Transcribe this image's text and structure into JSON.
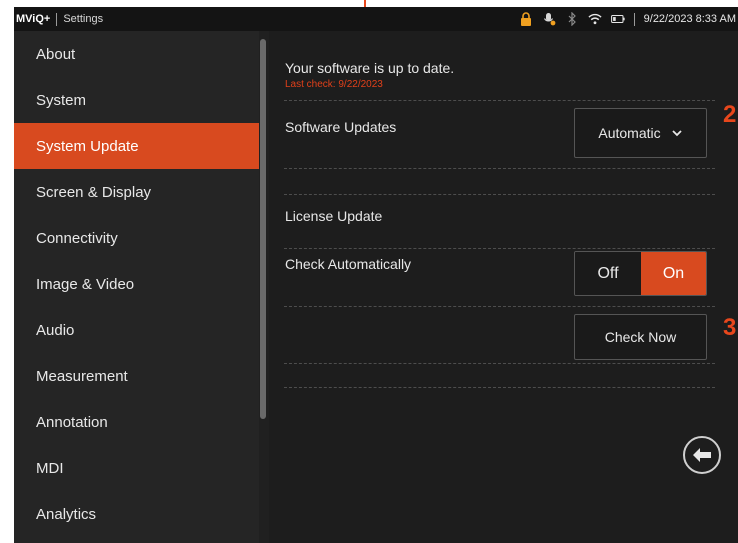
{
  "statusbar": {
    "app_name": "MViQ+",
    "screen_title": "Settings",
    "datetime": "9/22/2023  8:33 AM",
    "icons": [
      "lock-icon",
      "microphone-icon",
      "bluetooth-icon",
      "wifi-icon",
      "battery-icon"
    ]
  },
  "sidebar": {
    "items": [
      {
        "label": "About"
      },
      {
        "label": "System"
      },
      {
        "label": "System Update",
        "active": true
      },
      {
        "label": "Screen & Display"
      },
      {
        "label": "Connectivity"
      },
      {
        "label": "Image & Video"
      },
      {
        "label": "Audio"
      },
      {
        "label": "Measurement"
      },
      {
        "label": "Annotation"
      },
      {
        "label": "MDI"
      },
      {
        "label": "Analytics"
      }
    ]
  },
  "main": {
    "status": "Your software is up to date.",
    "last_check": "Last check: 9/22/2023",
    "software_updates_label": "Software Updates",
    "software_updates_value": "Automatic",
    "license_update_label": "License Update",
    "check_auto_label": "Check Automatically",
    "toggle_off": "Off",
    "toggle_on": "On",
    "toggle_value": "On",
    "check_now": "Check Now"
  },
  "callouts": {
    "two": "2",
    "three": "3"
  },
  "colors": {
    "accent": "#d84a1f",
    "callout": "#e8471c",
    "lock": "#f0a020"
  }
}
